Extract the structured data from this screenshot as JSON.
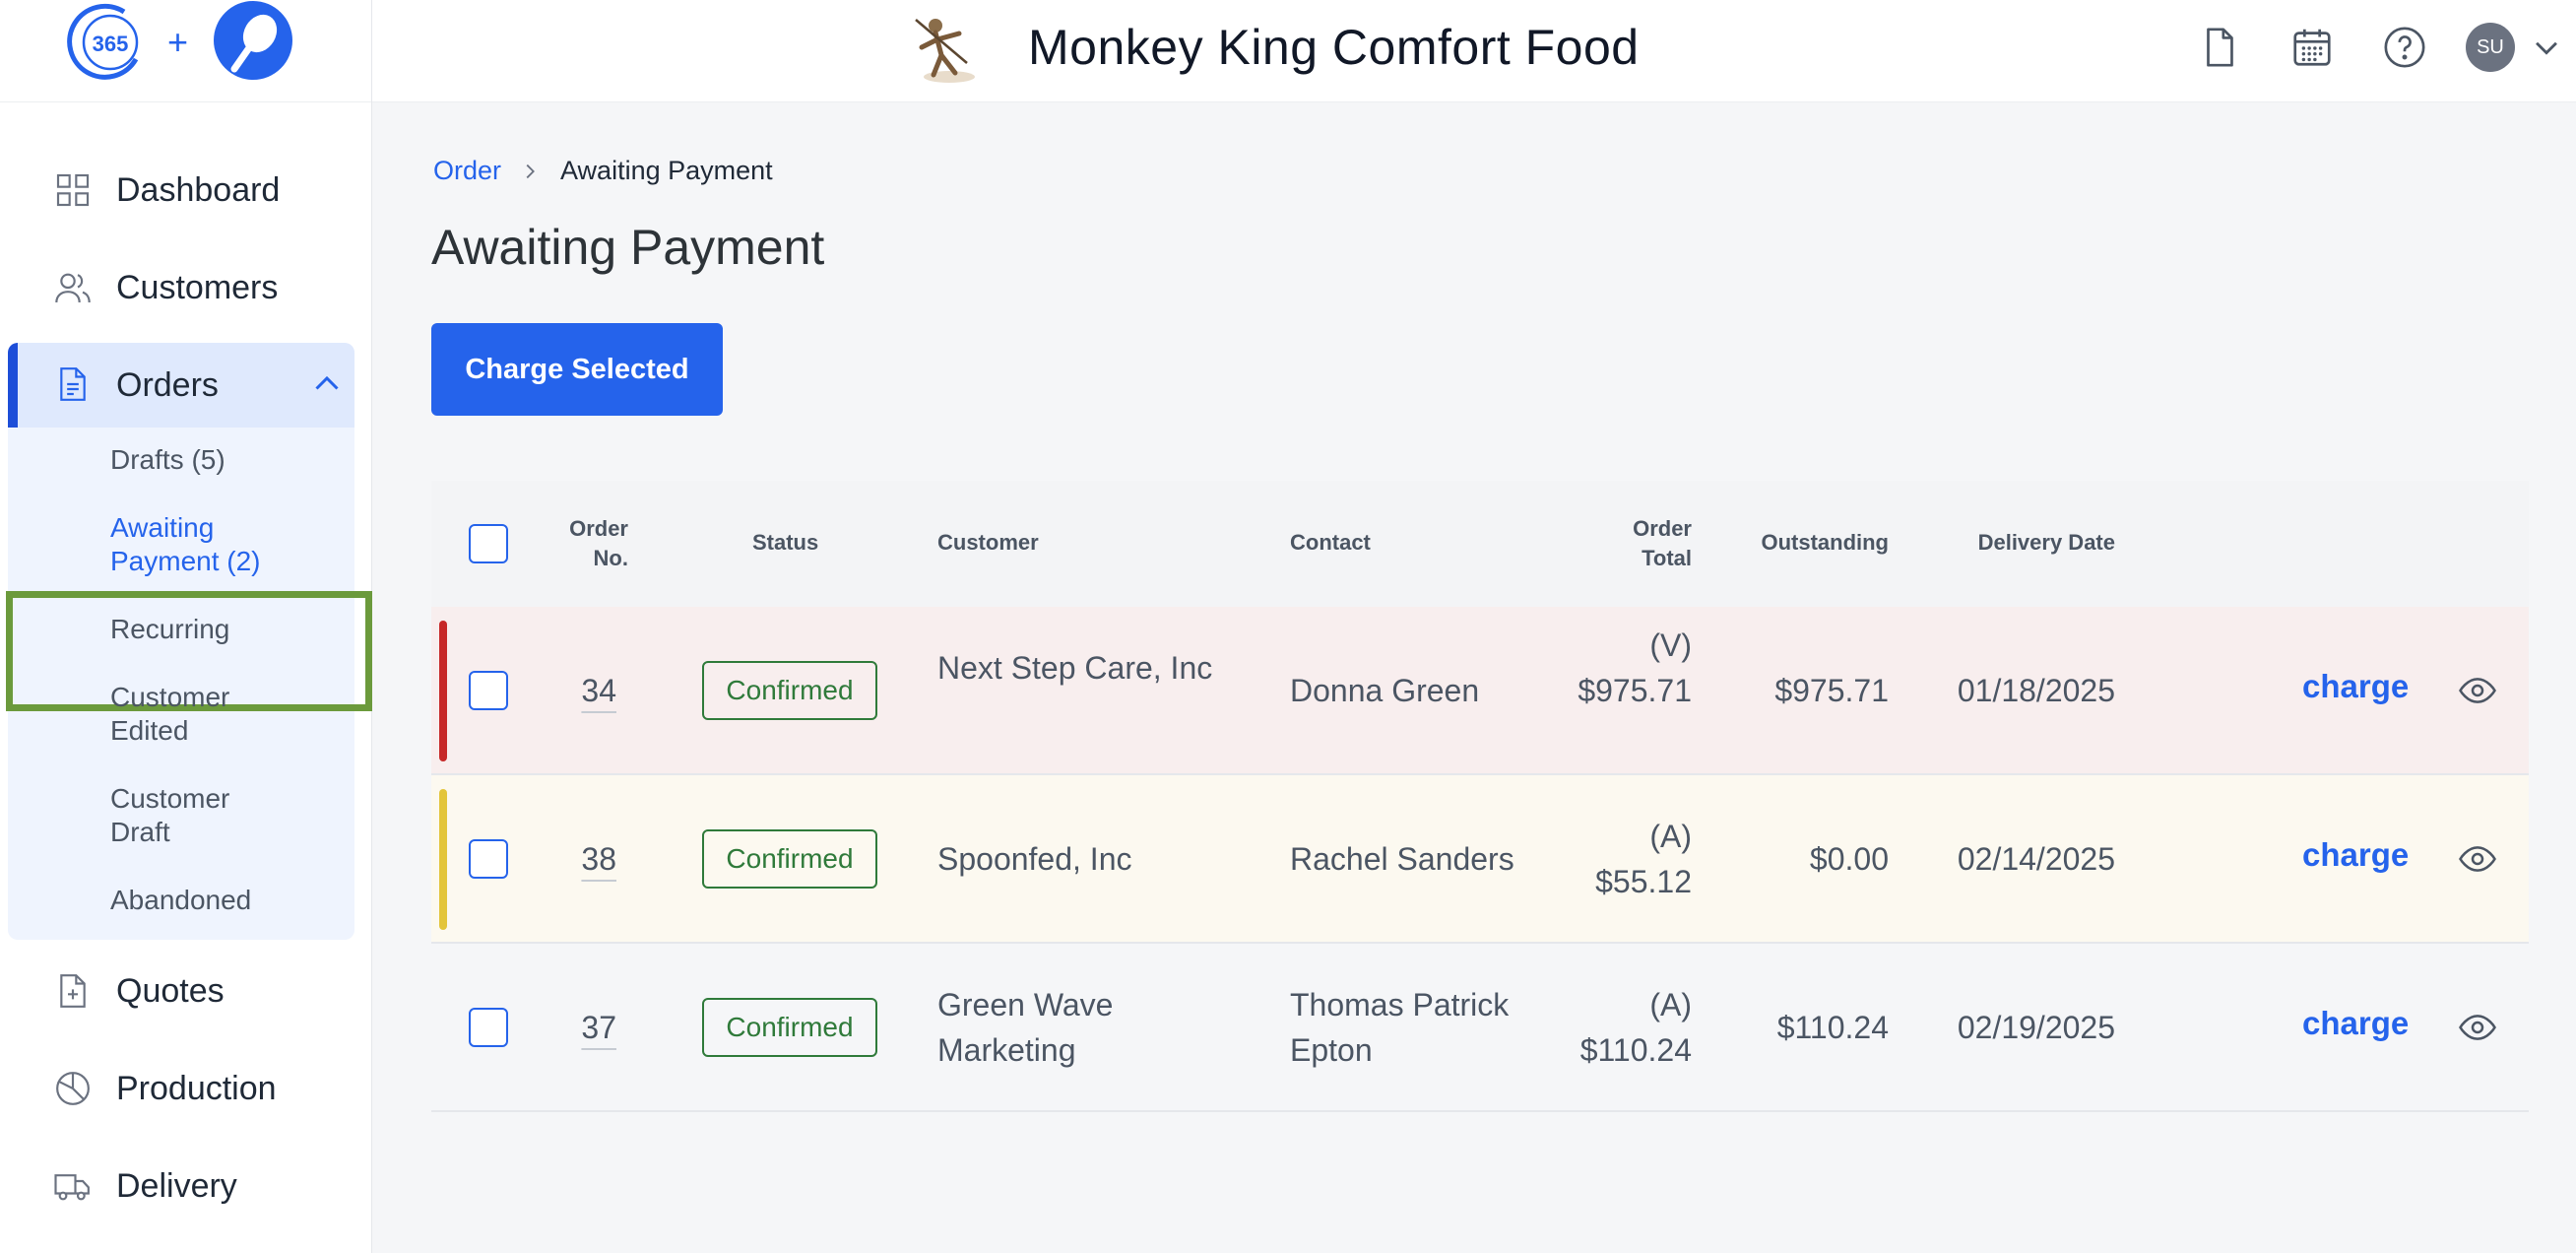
{
  "header": {
    "logo_text": "365",
    "logo_plus": "+",
    "company_name": "Monkey King Comfort Food",
    "icons": [
      "document-icon",
      "calendar-icon",
      "help-icon"
    ],
    "avatar_initials": "SU"
  },
  "sidebar": {
    "items": [
      {
        "label": "Dashboard",
        "icon": "dashboard-grid-icon"
      },
      {
        "label": "Customers",
        "icon": "users-icon"
      },
      {
        "label": "Orders",
        "icon": "orders-document-icon"
      },
      {
        "label": "Quotes",
        "icon": "quote-document-icon"
      },
      {
        "label": "Production",
        "icon": "pie-chart-icon"
      },
      {
        "label": "Delivery",
        "icon": "truck-icon"
      }
    ],
    "orders_sub": [
      {
        "label": "Drafts (5)"
      },
      {
        "label": "Awaiting Payment (2)"
      },
      {
        "label": "Recurring"
      },
      {
        "label": "Customer Edited"
      },
      {
        "label": "Customer Draft"
      },
      {
        "label": "Abandoned"
      }
    ]
  },
  "breadcrumb": {
    "parent": "Order",
    "current": "Awaiting Payment"
  },
  "page": {
    "title": "Awaiting Payment",
    "charge_selected_label": "Charge Selected"
  },
  "table": {
    "headers": {
      "order_no": "Order No.",
      "status": "Status",
      "customer": "Customer",
      "contact": "Contact",
      "order_total": "Order Total",
      "outstanding": "Outstanding",
      "delivery_date": "Delivery Date"
    },
    "rows": [
      {
        "order_no": "34",
        "status": "Confirmed",
        "customer": "Next Step Care, Inc",
        "contact": "Donna Green",
        "total_prefix": "(V)",
        "total": "$975.71",
        "outstanding": "$975.71",
        "delivery_date": "01/18/2025",
        "action": "charge",
        "indicator_color": "#c62828",
        "row_bg": "#f8eeee"
      },
      {
        "order_no": "38",
        "status": "Confirmed",
        "customer": "Spoonfed, Inc",
        "contact": "Rachel Sanders",
        "total_prefix": "(A)",
        "total": "$55.12",
        "outstanding": "$0.00",
        "delivery_date": "02/14/2025",
        "action": "charge",
        "indicator_color": "#e3c53a",
        "row_bg": "#fcf9f0"
      },
      {
        "order_no": "37",
        "status": "Confirmed",
        "customer": "Green Wave Marketing",
        "contact": "Thomas Patrick Epton",
        "total_prefix": "(A)",
        "total": "$110.24",
        "outstanding": "$110.24",
        "delivery_date": "02/19/2025",
        "action": "charge",
        "indicator_color": "",
        "row_bg": "#f5f6f8"
      }
    ]
  },
  "colors": {
    "accent": "#2563eb",
    "status_green": "#2f7a3a",
    "highlight_green": "#6b9a3c"
  }
}
